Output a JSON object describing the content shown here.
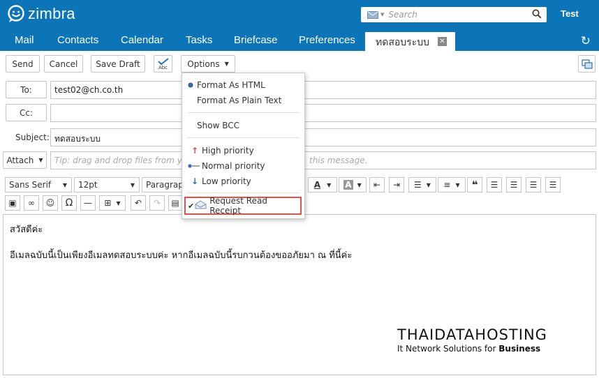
{
  "header": {
    "logo_text": "zimbra",
    "search_placeholder": "Search",
    "user_name": "Test"
  },
  "tabs": [
    {
      "label": "Mail"
    },
    {
      "label": "Contacts"
    },
    {
      "label": "Calendar"
    },
    {
      "label": "Tasks"
    },
    {
      "label": "Briefcase"
    },
    {
      "label": "Preferences"
    }
  ],
  "active_tab": {
    "label": "ทดสอบระบบ"
  },
  "toolbar": {
    "send": "Send",
    "cancel": "Cancel",
    "save_draft": "Save Draft",
    "spell_abc": "Abc",
    "options": "Options"
  },
  "compose": {
    "to_label": "To:",
    "to_value": "test02@ch.co.th",
    "cc_label": "Cc:",
    "cc_value": "",
    "subject_label": "Subject:",
    "subject_value": "ทดสอบระบบ",
    "attach_label": "Attach",
    "attach_tip": "Tip: drag and drop files from your desktop to add attachments to this message.",
    "attach_tip_visible_left": "Tip: drag and drop files from you",
    "attach_tip_visible_right": "this message."
  },
  "format_toolbar": {
    "font": "Sans Serif",
    "size": "12pt",
    "paragraph": "Paragraph"
  },
  "options_menu": {
    "format_html": "Format As HTML",
    "format_plain": "Format As Plain Text",
    "show_bcc": "Show BCC",
    "high_priority": "High priority",
    "normal_priority": "Normal priority",
    "low_priority": "Low priority",
    "read_receipt": "Request Read Receipt",
    "selected_format": "Format As HTML",
    "selected_priority": "Normal priority",
    "read_receipt_checked": true
  },
  "body": {
    "line1": "สวัสดีค่ะ",
    "line2": "อีเมลฉบับนี้เป็นเพียงอีเมลทดสอบระบบค่ะ หากอีเมลฉบับนี้รบกวนต้องขออภัยมา ณ ที่นี้ค่ะ"
  },
  "signature": {
    "brand": "THAIDATAHOSTING",
    "tagline_prefix": "It Network Solutions for ",
    "tagline_bold": "Business"
  },
  "colors": {
    "brand_blue": "#0b75b8",
    "highlight_border": "#d9534f",
    "high_priority": "#d9534f",
    "low_priority": "#2a6fbd"
  }
}
